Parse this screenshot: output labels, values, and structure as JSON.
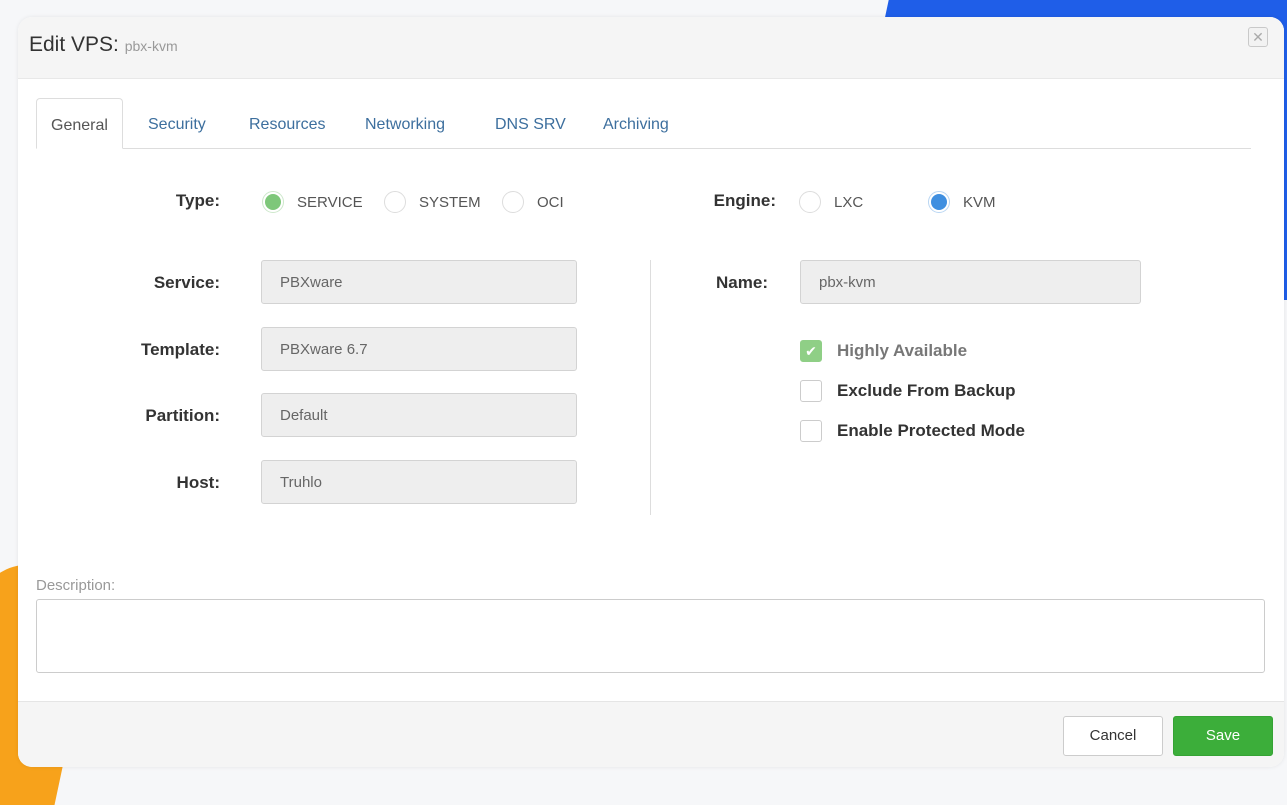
{
  "dialog": {
    "title": "Edit VPS:",
    "subtitle": "pbx-kvm",
    "close_icon": "close-icon"
  },
  "tabs": [
    {
      "label": "General",
      "active": true
    },
    {
      "label": "Security",
      "active": false
    },
    {
      "label": "Resources",
      "active": false
    },
    {
      "label": "Networking",
      "active": false
    },
    {
      "label": "DNS SRV",
      "active": false
    },
    {
      "label": "Archiving",
      "active": false
    }
  ],
  "type": {
    "label": "Type:",
    "options": [
      {
        "label": "SERVICE",
        "selected": true
      },
      {
        "label": "SYSTEM",
        "selected": false
      },
      {
        "label": "OCI",
        "selected": false
      }
    ]
  },
  "engine": {
    "label": "Engine:",
    "options": [
      {
        "label": "LXC",
        "selected": false
      },
      {
        "label": "KVM",
        "selected": true
      }
    ]
  },
  "fields": {
    "service": {
      "label": "Service:",
      "value": "PBXware"
    },
    "template": {
      "label": "Template:",
      "value": "PBXware 6.7"
    },
    "partition": {
      "label": "Partition:",
      "value": "Default"
    },
    "host": {
      "label": "Host:",
      "value": "Truhlo"
    },
    "name": {
      "label": "Name:",
      "value": "pbx-kvm"
    }
  },
  "checkboxes": [
    {
      "label": "Highly Available",
      "checked": true
    },
    {
      "label": "Exclude From Backup",
      "checked": false
    },
    {
      "label": "Enable Protected Mode",
      "checked": false
    }
  ],
  "description": {
    "label": "Description:",
    "value": ""
  },
  "footer": {
    "cancel": "Cancel",
    "save": "Save"
  },
  "colors": {
    "accent_blue": "#3d6f9e",
    "save_green": "#3cae3a",
    "radio_green": "#7ec77a",
    "radio_blue": "#3f8fe0",
    "check_green": "#8fcf86"
  }
}
